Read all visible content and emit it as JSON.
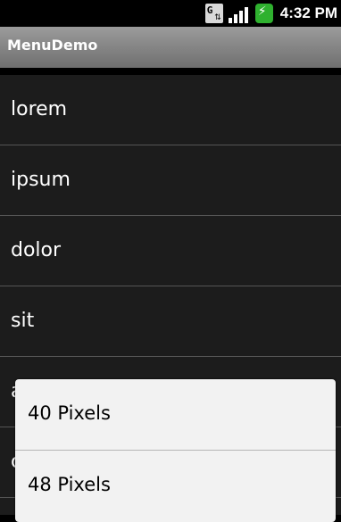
{
  "status_bar": {
    "time": "4:32 PM",
    "icons": [
      "sim-g-icon",
      "signal-icon",
      "battery-charging-icon"
    ]
  },
  "title_bar": {
    "title": "MenuDemo"
  },
  "list": {
    "items": [
      {
        "label": "lorem"
      },
      {
        "label": "ipsum"
      },
      {
        "label": "dolor"
      },
      {
        "label": "sit"
      },
      {
        "label": "amet"
      },
      {
        "label": "consectetuer"
      }
    ]
  },
  "popup_menu": {
    "items": [
      {
        "label": "40 Pixels"
      },
      {
        "label": "48 Pixels"
      }
    ]
  }
}
